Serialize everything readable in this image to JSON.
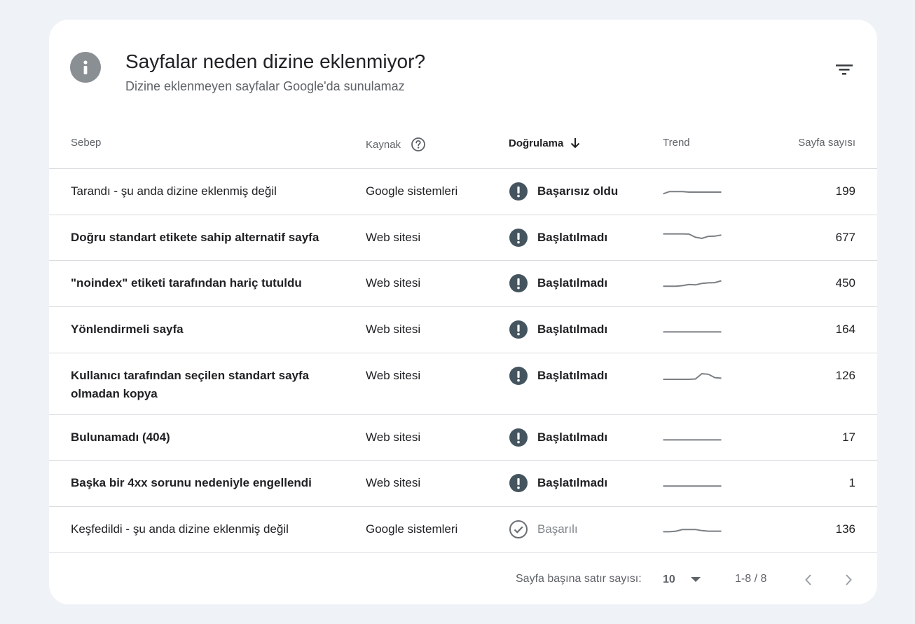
{
  "header": {
    "title": "Sayfalar neden dizine eklenmiyor?",
    "subtitle": "Dizine eklenmeyen sayfalar Google'da sunulamaz",
    "icons": {
      "info": "info-icon",
      "filter": "filter-icon"
    }
  },
  "table": {
    "columns": {
      "sebep": "Sebep",
      "kaynak": "Kaynak",
      "dogrulama": "Doğrulama",
      "trend": "Trend",
      "count": "Sayfa sayısı"
    },
    "sorted_by": "Doğrulama",
    "sort_direction": "descending",
    "rows": [
      {
        "sebep": "Tarandı - şu anda dizine eklenmiş değil",
        "bold": false,
        "kaynak": "Google sistemleri",
        "status": "Başarısız oldu",
        "status_type": "error",
        "count": "199",
        "trend": [
          0.35,
          0.55,
          0.55,
          0.55,
          0.5,
          0.5,
          0.5,
          0.5,
          0.5,
          0.5
        ]
      },
      {
        "sebep": "Doğru standart etikete sahip alternatif sayfa",
        "bold": true,
        "kaynak": "Web sitesi",
        "status": "Başlatılmadı",
        "status_type": "error",
        "count": "677",
        "trend": [
          0.9,
          0.9,
          0.9,
          0.9,
          0.88,
          0.6,
          0.5,
          0.68,
          0.7,
          0.8
        ]
      },
      {
        "sebep": "\"noindex\" etiketi tarafından hariç tutuldu",
        "bold": true,
        "kaynak": "Web sitesi",
        "status": "Başlatılmadı",
        "status_type": "error",
        "count": "450",
        "trend": [
          0.3,
          0.3,
          0.3,
          0.35,
          0.45,
          0.42,
          0.55,
          0.6,
          0.62,
          0.78
        ]
      },
      {
        "sebep": "Yönlendirmeli sayfa",
        "bold": true,
        "kaynak": "Web sitesi",
        "status": "Başlatılmadı",
        "status_type": "error",
        "count": "164",
        "trend": [
          0.35,
          0.35,
          0.35,
          0.35,
          0.35,
          0.35,
          0.35,
          0.35,
          0.35,
          0.35
        ]
      },
      {
        "sebep": "Kullanıcı tarafından seçilen standart sayfa olmadan kopya",
        "bold": true,
        "kaynak": "Web sitesi",
        "status": "Başlatılmadı",
        "status_type": "error",
        "count": "126",
        "trend": [
          0.25,
          0.25,
          0.25,
          0.25,
          0.25,
          0.28,
          0.75,
          0.7,
          0.4,
          0.35
        ]
      },
      {
        "sebep": "Bulunamadı (404)",
        "bold": true,
        "kaynak": "Web sitesi",
        "status": "Başlatılmadı",
        "status_type": "error",
        "count": "17",
        "trend": [
          0.35,
          0.35,
          0.35,
          0.35,
          0.35,
          0.35,
          0.35,
          0.35,
          0.35,
          0.35
        ]
      },
      {
        "sebep": "Başka bir 4xx sorunu nedeniyle engellendi",
        "bold": true,
        "kaynak": "Web sitesi",
        "status": "Başlatılmadı",
        "status_type": "error",
        "count": "1",
        "trend": [
          0.3,
          0.3,
          0.3,
          0.3,
          0.3,
          0.3,
          0.3,
          0.3,
          0.3,
          0.3
        ]
      },
      {
        "sebep": "Keşfedildi - şu anda dizine eklenmiş değil",
        "bold": false,
        "kaynak": "Google sistemleri",
        "status": "Başarılı",
        "status_type": "success",
        "count": "136",
        "trend": [
          0.35,
          0.35,
          0.4,
          0.55,
          0.55,
          0.55,
          0.45,
          0.4,
          0.4,
          0.4
        ]
      }
    ]
  },
  "footer": {
    "rows_per_page_label": "Sayfa başına satır sayısı:",
    "rows_per_page_value": "10",
    "range": "1-8 / 8"
  },
  "colors": {
    "background": "#eff2f7",
    "card": "#ffffff",
    "status_error": "#45555f",
    "status_success": "#6b7075",
    "trend_line": "#7a7f84",
    "info_icon": "#8a8f94"
  }
}
